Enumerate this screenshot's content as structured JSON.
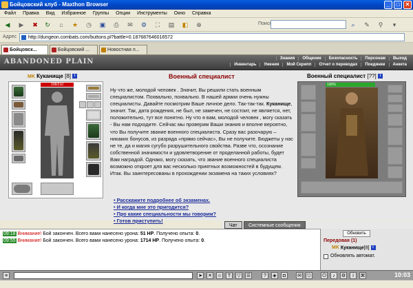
{
  "window": {
    "title": "Бойцовский клуб - Maxthon Browser",
    "minimize": "_",
    "maximize": "□",
    "close": "✕"
  },
  "menu": [
    "Файл",
    "Правка",
    "Вид",
    "Избранное",
    "Группы",
    "Опции",
    "Инструменты",
    "Окно",
    "Справка"
  ],
  "toolbar": {
    "search_label": "Поиск:"
  },
  "address": {
    "label": "Адрес",
    "url": "http://dungeon.combats.com/buttons.pl?battle=0.187687646016572"
  },
  "tabs": [
    {
      "label": "Бойцовск...",
      "active": true
    },
    {
      "label": "Бойцовский ...",
      "active": false
    },
    {
      "label": "Новостная л...",
      "active": false
    }
  ],
  "game": {
    "logo": "ABANDONED PLAIN",
    "nav_top": [
      "Знания",
      "Общение",
      "Безопасность",
      "Персонаж",
      "Выход"
    ],
    "nav_bottom": [
      "Инвентарь",
      "Умения",
      "Мой Скрипп",
      "Отчет о переводах",
      "Поединки",
      "Анкета"
    ]
  },
  "player": {
    "name": "Куканище",
    "level": "[8]",
    "hp": "208/210",
    "info_badge": "i",
    "clan": "MK"
  },
  "npc": {
    "title": "Военный специалист",
    "name": "Военный специалист",
    "level": "[??]",
    "info_badge": "i",
    "hp_percent": "100%",
    "hp_fraction": 1.0
  },
  "dialogue": {
    "p1a": "Ну что же, молодой человек . Значит, Вы решили стать военным специалистом. Похвально, похвально. В нашей армии очень нужны специалисты. Давайте посмотрим Ваше личное дело. Так-так-так. ",
    "p1name": "Куканище",
    "p1b": ", значит. Так, дата рождения, не был, не замечен, не состоит, не является, нет, положительно, тут все понятно. Ну что я вам, молодой человек , могу сказать - Вы нам подходите. Сейчас мы проверим Ваши знания и вполне вероятно, что Вы получите звание военного специалиста. Сразу вас разочарую – никаких бонусов, из разряда «прямо сейчас», Вы не получите. Бюджеты у нас не те, да и магия сугубо разрушительного свойства. Разве что, осознание собственной значимости и удовлетворение от проделанной работы, будет Вам наградой. Однако, могу сказать, что звание военного специалиста возможно откроет для вас несколько приятных возможностей в будущем. Итак. Вы заинтересованы в прохождении экзамена на таких условиях?"
  },
  "options": [
    "• Расскажите подробнее об экзаменах.",
    "• И когда мне это пригодится?",
    "• Про какие специальности мы говорим?",
    "• Готов приступить!"
  ],
  "chat_tabs": {
    "chat": "Чат",
    "system": "Системные сообщения"
  },
  "chat": [
    {
      "time": "09:18",
      "warn": "Внимание!",
      "text": " Бой закончен. Всего вами нанесено урона: ",
      "damage": "51 HP",
      "mid": ". Получено опыта: ",
      "exp": "0",
      "end": "."
    },
    {
      "time": "09:55",
      "warn": "Внимание!",
      "text": " Бой закончен. Всего вами нанесено урона: ",
      "damage": "1714 HP",
      "mid": ". Получено опыта: ",
      "exp": "0",
      "end": "."
    }
  ],
  "sidebar": {
    "refresh": "Обновить",
    "location": "Передовая (1)",
    "player": "Куканище",
    "player_level": "[8]",
    "auto_refresh": "Обновлять автомат."
  },
  "clock": "10:03",
  "colors": {
    "accent_red": "#8b0000",
    "link_blue": "#1a2a9a",
    "titlebar": "#0046c8",
    "hp_red": "#cc0000",
    "hp_green": "#2aa82a"
  }
}
